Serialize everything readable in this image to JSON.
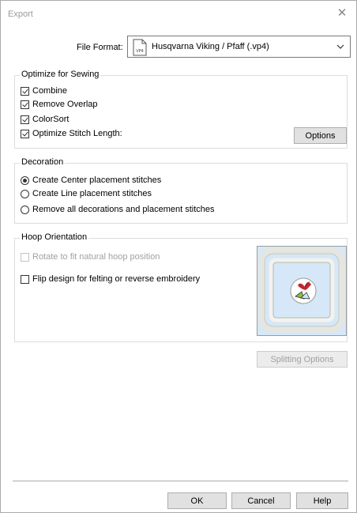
{
  "window": {
    "title": "Export"
  },
  "file_format": {
    "label": "File Format:",
    "icon_text": "VP4",
    "value": "Husqvarna Viking / Pfaff (.vp4)"
  },
  "optimize": {
    "title": "Optimize for Sewing",
    "items": [
      {
        "label": "Combine",
        "checked": true
      },
      {
        "label": "Remove Overlap",
        "checked": true
      },
      {
        "label": "ColorSort",
        "checked": true
      },
      {
        "label": "Optimize Stitch Length:",
        "checked": true
      }
    ],
    "options_button": "Options"
  },
  "decoration": {
    "title": "Decoration",
    "options": [
      {
        "label": "Create Center placement stitches",
        "selected": true
      },
      {
        "label": "Create Line placement stitches",
        "selected": false
      },
      {
        "label": "Remove all decorations and placement stitches",
        "selected": false
      }
    ]
  },
  "hoop": {
    "title": "Hoop Orientation",
    "rotate": {
      "label": "Rotate to fit natural hoop position",
      "checked": false,
      "enabled": false
    },
    "flip": {
      "label": "Flip design for felting or reverse embroidery",
      "checked": false,
      "enabled": true
    }
  },
  "splitting_button": "Splitting Options",
  "buttons": {
    "ok": "OK",
    "cancel": "Cancel",
    "help": "Help"
  },
  "colors": {
    "preview_bg": "#d6e7f7",
    "hoop_frame": "#e6e6e0",
    "disabled_text": "#a0a0a0"
  }
}
